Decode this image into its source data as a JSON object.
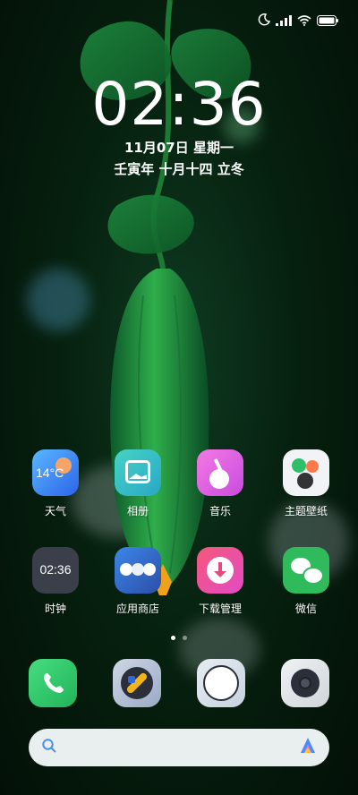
{
  "lock_info": {
    "time": "02:36",
    "date": "11月07日 星期一",
    "lunar": "壬寅年 十月十四 立冬"
  },
  "apps": [
    {
      "label": "天气",
      "icon": "weather-icon",
      "temperature": "14°C"
    },
    {
      "label": "相册",
      "icon": "gallery-icon"
    },
    {
      "label": "音乐",
      "icon": "music-icon"
    },
    {
      "label": "主题壁纸",
      "icon": "themes-icon"
    },
    {
      "label": "时钟",
      "icon": "clock-icon",
      "time": "02:36"
    },
    {
      "label": "应用商店",
      "icon": "app-store-icon"
    },
    {
      "label": "下载管理",
      "icon": "downloads-icon"
    },
    {
      "label": "微信",
      "icon": "wechat-icon"
    }
  ],
  "dock": [
    {
      "icon": "phone-icon"
    },
    {
      "icon": "browser-icon"
    },
    {
      "icon": "messages-icon"
    },
    {
      "icon": "camera-icon"
    }
  ],
  "page_indicator": {
    "current_page": 1,
    "total_pages": 2
  },
  "search": {
    "placeholder": ""
  },
  "colors": {
    "wallpaper": "#06210f",
    "weather_bg": "#2f8cf0",
    "gallery_bg": "#35c7b7",
    "music_bg": "#e35bd7",
    "clock_bg": "#3a3f4a",
    "store_bg": "#3a7ed6",
    "downloads_bg": "#e64b7c",
    "wechat_bg": "#2fbb5b",
    "phone_bg": "#2fc86a",
    "search_bg": "#e9efee"
  }
}
